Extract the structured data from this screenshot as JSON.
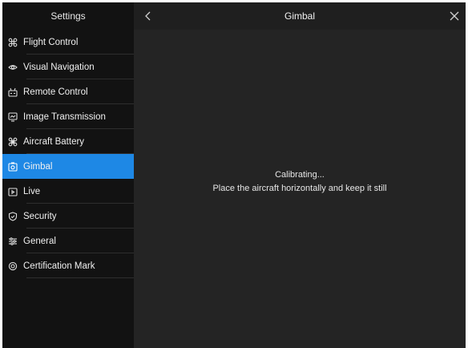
{
  "sidebar": {
    "title": "Settings",
    "items": [
      {
        "label": "Flight Control",
        "icon": "drone-icon"
      },
      {
        "label": "Visual Navigation",
        "icon": "eye-icon"
      },
      {
        "label": "Remote Control",
        "icon": "remote-icon"
      },
      {
        "label": "Image Transmission",
        "icon": "image-transmission-icon"
      },
      {
        "label": "Aircraft Battery",
        "icon": "battery-icon"
      },
      {
        "label": "Gimbal",
        "icon": "gimbal-icon",
        "active": true
      },
      {
        "label": "Live",
        "icon": "live-icon"
      },
      {
        "label": "Security",
        "icon": "shield-icon"
      },
      {
        "label": "General",
        "icon": "sliders-icon"
      },
      {
        "label": "Certification Mark",
        "icon": "certificate-icon"
      }
    ]
  },
  "header": {
    "title": "Gimbal",
    "back_icon": "chevron-left-icon",
    "close_icon": "close-icon"
  },
  "main": {
    "status": "Calibrating...",
    "instruction": "Place the aircraft horizontally and keep it still"
  },
  "colors": {
    "accent": "#1e88e5",
    "sidebar_bg": "#121212",
    "content_bg": "#242424"
  }
}
